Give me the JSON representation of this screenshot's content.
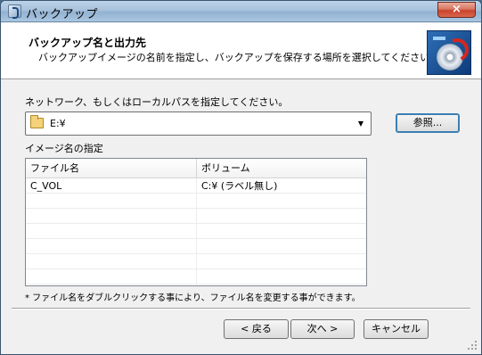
{
  "window": {
    "title": "バックアップ",
    "close_label": "×"
  },
  "header": {
    "title": "バックアップ名と出力先",
    "description": "バックアップイメージの名前を指定し、バックアップを保存する場所を選択してください。"
  },
  "path": {
    "label": "ネットワーク、もしくはローカルパスを指定してください。",
    "value": "E:¥",
    "browse_label": "参照..."
  },
  "image_name": {
    "label": "イメージ名の指定",
    "columns": [
      "ファイル名",
      "ボリューム"
    ],
    "rows": [
      [
        "C_VOL",
        "C:¥ (ラベル無し)"
      ]
    ],
    "note": "* ファイル名をダブルクリックする事により、ファイル名を変更する事ができます。"
  },
  "footer": {
    "back_label": "< 戻る",
    "next_label": "次へ >",
    "cancel_label": "キャンセル"
  },
  "icons": {
    "app": "app-backup-icon",
    "folder": "folder-icon",
    "dropdown": "chevron-down-icon",
    "header_logo": "backup-disc-icon"
  }
}
